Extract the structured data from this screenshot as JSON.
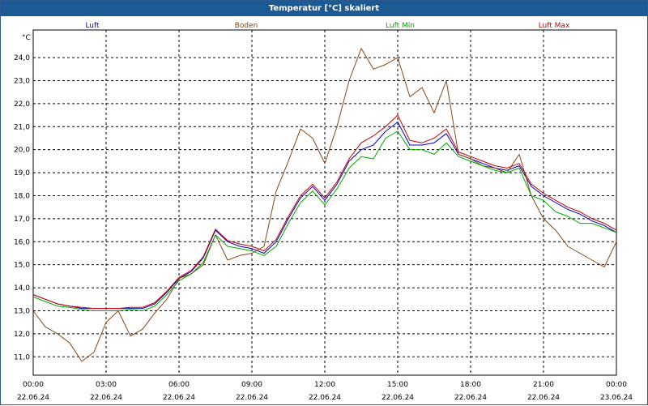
{
  "window": {
    "title": "Temperatur [°C] skaliert"
  },
  "chart_data": {
    "type": "line",
    "title": "Temperatur [°C] skaliert",
    "ylabel": "°C",
    "xlabel": "",
    "ylim": [
      10.2,
      25.2
    ],
    "yticks": [
      11.0,
      12.0,
      13.0,
      14.0,
      15.0,
      16.0,
      17.0,
      18.0,
      19.0,
      20.0,
      21.0,
      22.0,
      23.0,
      24.0
    ],
    "ytick_labels": [
      "11,0",
      "12,0",
      "13,0",
      "14,0",
      "15,0",
      "16,0",
      "17,0",
      "18,0",
      "19,0",
      "20,0",
      "21,0",
      "22,0",
      "23,0",
      "24,0"
    ],
    "xlim_hours": [
      0,
      24
    ],
    "xticks": [
      {
        "time": "00:00",
        "date": "22.06.24"
      },
      {
        "time": "03:00",
        "date": "22.06.24"
      },
      {
        "time": "06:00",
        "date": "22.06.24"
      },
      {
        "time": "09:00",
        "date": "22.06.24"
      },
      {
        "time": "12:00",
        "date": "22.06.24"
      },
      {
        "time": "15:00",
        "date": "22.06.24"
      },
      {
        "time": "18:00",
        "date": "22.06.24"
      },
      {
        "time": "21:00",
        "date": "22.06.24"
      },
      {
        "time": "00:00",
        "date": "23.06.24"
      }
    ],
    "grid": true,
    "legend_position": "top",
    "x_hours": [
      0,
      0.5,
      1,
      1.5,
      2,
      2.5,
      3,
      3.5,
      4,
      4.5,
      5,
      5.5,
      6,
      6.5,
      7,
      7.5,
      8,
      8.5,
      9,
      9.5,
      10,
      10.5,
      11,
      11.5,
      12,
      12.5,
      13,
      13.5,
      14,
      14.5,
      15,
      15.5,
      16,
      16.5,
      17,
      17.5,
      18,
      18.5,
      19,
      19.5,
      20,
      20.5,
      21,
      21.5,
      22,
      22.5,
      23,
      23.5,
      24
    ],
    "series": [
      {
        "name": "Luft",
        "color": "#0000cc",
        "values": [
          13.7,
          13.5,
          13.3,
          13.2,
          13.1,
          13.1,
          13.1,
          13.1,
          13.1,
          13.1,
          13.3,
          13.8,
          14.4,
          14.7,
          15.3,
          16.5,
          16.0,
          15.8,
          15.7,
          15.5,
          16.0,
          17.0,
          17.9,
          18.4,
          17.8,
          18.5,
          19.5,
          20.0,
          20.2,
          20.8,
          21.2,
          20.2,
          20.2,
          20.3,
          20.7,
          19.8,
          19.6,
          19.4,
          19.2,
          19.1,
          19.3,
          18.4,
          18.0,
          17.7,
          17.4,
          17.2,
          16.9,
          16.7,
          16.4
        ]
      },
      {
        "name": "Boden",
        "color": "#8b4513",
        "values": [
          13.0,
          12.3,
          12.0,
          11.6,
          10.8,
          11.2,
          12.5,
          13.0,
          11.9,
          12.2,
          12.9,
          13.5,
          14.4,
          14.6,
          15.0,
          16.3,
          15.2,
          15.4,
          15.5,
          15.8,
          18.2,
          19.5,
          20.9,
          20.5,
          19.4,
          21.0,
          23.0,
          24.4,
          23.5,
          23.7,
          24.0,
          22.3,
          22.7,
          21.6,
          23.0,
          19.8,
          19.6,
          19.3,
          19.2,
          19.0,
          19.8,
          18.0,
          17.0,
          16.5,
          15.8,
          15.5,
          15.2,
          14.9,
          16.0
        ]
      },
      {
        "name": "Luft Min",
        "color": "#00aa00",
        "values": [
          13.6,
          13.4,
          13.2,
          13.15,
          13.05,
          13.0,
          13.0,
          13.0,
          13.05,
          13.0,
          13.2,
          13.7,
          14.3,
          14.6,
          15.1,
          16.3,
          15.8,
          15.7,
          15.6,
          15.4,
          15.8,
          16.8,
          17.7,
          18.2,
          17.6,
          18.3,
          19.2,
          19.7,
          19.6,
          20.5,
          20.8,
          20.0,
          20.0,
          19.8,
          20.3,
          19.7,
          19.5,
          19.3,
          19.1,
          19.0,
          19.2,
          18.0,
          17.8,
          17.3,
          17.1,
          16.8,
          16.8,
          16.6,
          16.4
        ]
      },
      {
        "name": "Luft Max",
        "color": "#cc0000",
        "values": [
          13.7,
          13.5,
          13.3,
          13.2,
          13.15,
          13.1,
          13.1,
          13.1,
          13.15,
          13.15,
          13.35,
          13.85,
          14.45,
          14.75,
          15.35,
          16.55,
          16.05,
          15.9,
          15.8,
          15.6,
          16.1,
          17.1,
          18.0,
          18.5,
          17.9,
          18.6,
          19.6,
          20.3,
          20.6,
          21.0,
          21.5,
          20.4,
          20.3,
          20.5,
          20.9,
          19.9,
          19.7,
          19.5,
          19.3,
          19.2,
          19.4,
          18.5,
          18.1,
          17.8,
          17.5,
          17.3,
          17.0,
          16.8,
          16.5
        ]
      }
    ]
  }
}
